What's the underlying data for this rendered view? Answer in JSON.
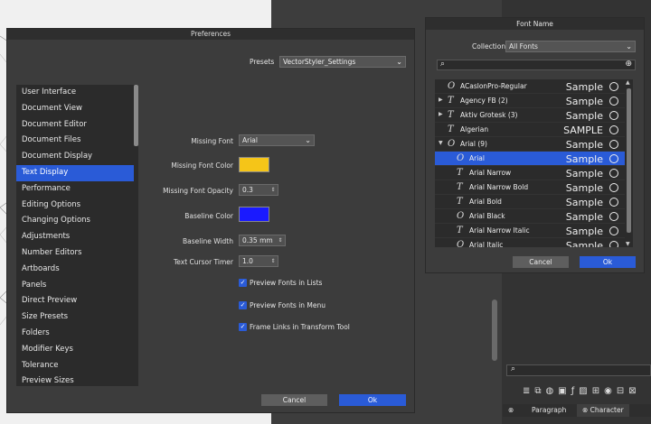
{
  "preferences": {
    "title": "Preferences",
    "presets_label": "Presets",
    "presets_value": "VectorStyler_Settings",
    "categories": [
      "User Interface",
      "Document View",
      "Document Editor",
      "Document Files",
      "Document Display",
      "Text Display",
      "Performance",
      "Editing Options",
      "Changing Options",
      "Adjustments",
      "Number Editors",
      "Artboards",
      "Panels",
      "Direct Preview",
      "Size Presets",
      "Folders",
      "Modifier Keys",
      "Tolerance",
      "Preview Sizes"
    ],
    "selected_category": "Text Display",
    "missing_font_label": "Missing Font",
    "missing_font_value": "Arial",
    "missing_font_color_label": "Missing Font Color",
    "missing_font_color": "#f5c518",
    "missing_font_opacity_label": "Missing Font Opacity",
    "missing_font_opacity": "0.3",
    "baseline_color_label": "Baseline Color",
    "baseline_color": "#1a1aff",
    "baseline_width_label": "Baseline Width",
    "baseline_width": "0.35 mm",
    "text_cursor_timer_label": "Text Cursor Timer",
    "text_cursor_timer": "1.0",
    "preview_fonts_lists": "Preview Fonts in Lists",
    "preview_fonts_menu": "Preview Fonts in Menu",
    "frame_links": "Frame Links in Transform Tool",
    "cancel": "Cancel",
    "ok": "Ok"
  },
  "font_dialog": {
    "title": "Font Name",
    "collection_label": "Collection",
    "collection_value": "All Fonts",
    "fonts": [
      {
        "name": "ACaslonPro-Regular",
        "icon": "O",
        "sample": "Sample",
        "expand": ""
      },
      {
        "name": "Agency FB (2)",
        "icon": "T",
        "sample": "Sample",
        "expand": "▶"
      },
      {
        "name": "Aktiv Grotesk (3)",
        "icon": "T",
        "sample": "Sample",
        "expand": "▶"
      },
      {
        "name": "Algerian",
        "icon": "T",
        "sample": "SAMPLE",
        "expand": ""
      },
      {
        "name": "Arial (9)",
        "icon": "O",
        "sample": "Sample",
        "expand": "▼"
      },
      {
        "name": "Arial",
        "icon": "O",
        "sample": "Sample",
        "expand": ""
      },
      {
        "name": "Arial Narrow",
        "icon": "T",
        "sample": "Sample",
        "expand": ""
      },
      {
        "name": "Arial Narrow Bold",
        "icon": "T",
        "sample": "Sample",
        "expand": ""
      },
      {
        "name": "Arial Bold",
        "icon": "T",
        "sample": "Sample",
        "expand": ""
      },
      {
        "name": "Arial Black",
        "icon": "O",
        "sample": "Sample",
        "expand": ""
      },
      {
        "name": "Arial Narrow Italic",
        "icon": "T",
        "sample": "Sample",
        "expand": ""
      },
      {
        "name": "Arial Italic",
        "icon": "O",
        "sample": "Sample",
        "expand": ""
      }
    ],
    "selected_font": "Arial",
    "cancel": "Cancel",
    "ok": "Ok"
  },
  "right_panel": {
    "tab_paragraph": "Paragraph",
    "tab_character": "Character"
  }
}
